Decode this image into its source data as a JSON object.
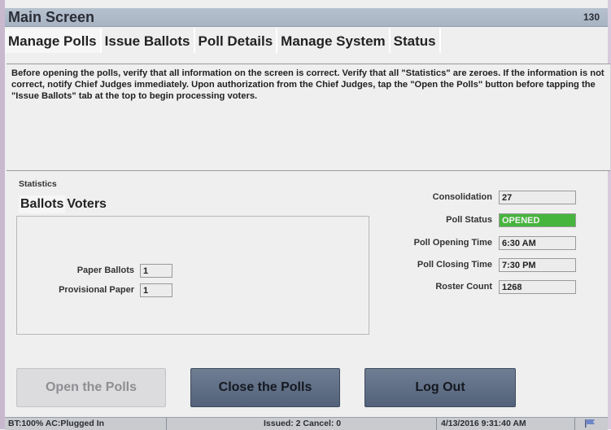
{
  "title": "Main Screen",
  "screen_number": "130",
  "tabs": [
    {
      "label": "Manage Polls",
      "active": true
    },
    {
      "label": "Issue Ballots",
      "active": false
    },
    {
      "label": "Poll Details",
      "active": false
    },
    {
      "label": "Manage System",
      "active": false
    },
    {
      "label": "Status",
      "active": false
    }
  ],
  "instructions": "Before opening the polls, verify that all information on the screen is correct. Verify that all \"Statistics\" are zeroes. If the information is not correct, notify Chief Judges immediately. Upon authorization from the Chief Judges, tap the \"Open the Polls\" button before tapping the \"Issue Ballots\" tab at the top to begin processing voters.",
  "statistics": {
    "label": "Statistics",
    "subtabs": [
      {
        "label": "Ballots",
        "active": true
      },
      {
        "label": "Voters",
        "active": false
      }
    ],
    "paper_ballots": {
      "label": "Paper Ballots",
      "value": "1"
    },
    "provisional_paper": {
      "label": "Provisional Paper",
      "value": "1"
    }
  },
  "details": {
    "consolidation": {
      "label": "Consolidation",
      "value": "27"
    },
    "poll_status": {
      "label": "Poll Status",
      "value": "OPENED",
      "color": "#46b53d"
    },
    "poll_opening_time": {
      "label": "Poll Opening Time",
      "value": "6:30 AM"
    },
    "poll_closing_time": {
      "label": "Poll Closing Time",
      "value": "7:30 PM"
    },
    "roster_count": {
      "label": "Roster Count",
      "value": "1268"
    }
  },
  "buttons": {
    "open_polls": {
      "label": "Open the Polls",
      "enabled": false
    },
    "close_polls": {
      "label": "Close the Polls",
      "enabled": true
    },
    "log_out": {
      "label": "Log Out",
      "enabled": true
    }
  },
  "status_bar": {
    "power": "BT:100% AC:Plugged In",
    "issued": "Issued: 2 Cancel: 0",
    "datetime": "4/13/2016 9:31:40 AM",
    "icon": "flag-icon"
  }
}
